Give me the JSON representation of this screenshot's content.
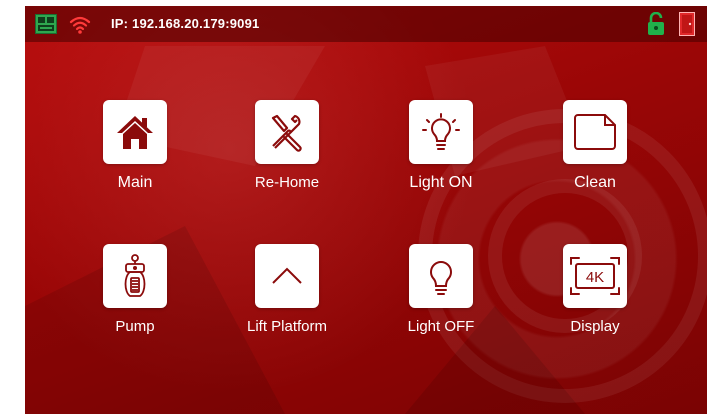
{
  "status_bar": {
    "ip_text": "IP: 192.168.20.179:9091",
    "icons": [
      "sd-card-icon",
      "wifi-icon",
      "unlock-icon",
      "door-icon"
    ]
  },
  "tiles": [
    {
      "label": "Main",
      "icon": "home-icon"
    },
    {
      "label": "Re-Home",
      "icon": "tools-icon"
    },
    {
      "label": "Light ON",
      "icon": "light-on-icon"
    },
    {
      "label": "Clean",
      "icon": "clean-icon"
    },
    {
      "label": "Pump",
      "icon": "pump-icon"
    },
    {
      "label": "Lift Platform",
      "icon": "chevron-up-icon"
    },
    {
      "label": "Light OFF",
      "icon": "light-off-icon"
    },
    {
      "label": "Display",
      "icon": "display-4k-icon"
    }
  ],
  "display_badge": "4K",
  "colors": {
    "background": "#a00707",
    "icon_dark_red": "#8b0b0b",
    "sd_green": "#2fa84f",
    "lock_green": "#21b14b",
    "door_red": "#e0282a"
  }
}
